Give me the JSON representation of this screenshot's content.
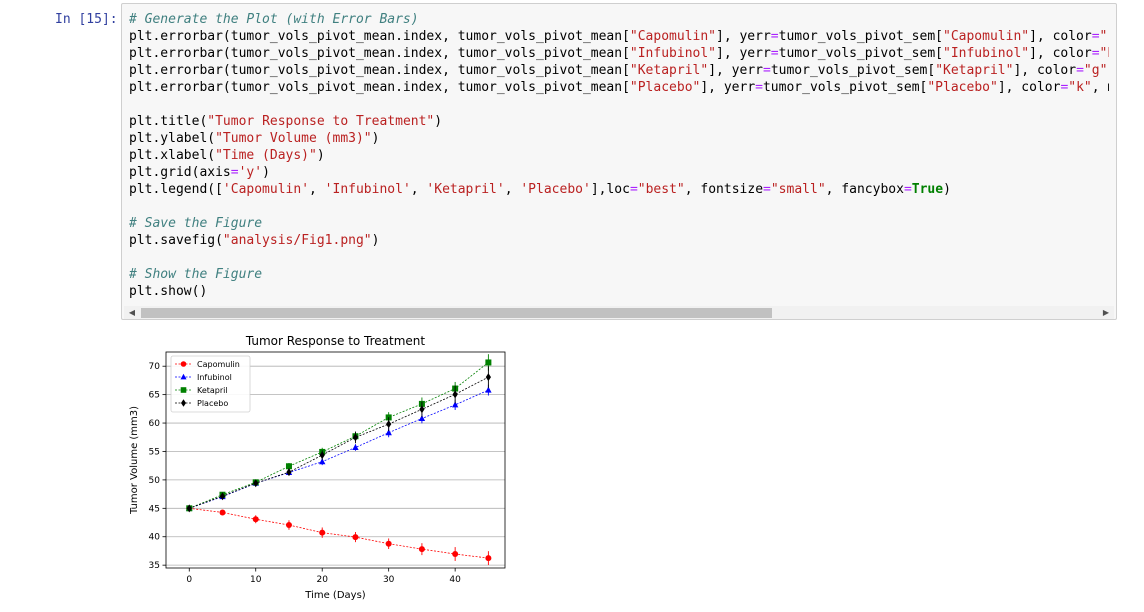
{
  "cell": {
    "prompt": "In [15]:",
    "code_lines": [
      [
        {
          "t": "# Generate the Plot (with Error Bars)",
          "c": "cm"
        }
      ],
      [
        {
          "t": "plt.errorbar(tumor_vols_pivot_mean.index, tumor_vols_pivot_mean["
        },
        {
          "t": "\"Capomulin\"",
          "c": "st"
        },
        {
          "t": "], yerr"
        },
        {
          "t": "=",
          "c": "op"
        },
        {
          "t": "tumor_vols_pivot_sem["
        },
        {
          "t": "\"Capomulin\"",
          "c": "st"
        },
        {
          "t": "], color"
        },
        {
          "t": "=",
          "c": "op"
        },
        {
          "t": "\"r\"",
          "c": "st"
        },
        {
          "t": ", "
        }
      ],
      [
        {
          "t": "plt.errorbar(tumor_vols_pivot_mean.index, tumor_vols_pivot_mean["
        },
        {
          "t": "\"Infubinol\"",
          "c": "st"
        },
        {
          "t": "], yerr"
        },
        {
          "t": "=",
          "c": "op"
        },
        {
          "t": "tumor_vols_pivot_sem["
        },
        {
          "t": "\"Infubinol\"",
          "c": "st"
        },
        {
          "t": "], color"
        },
        {
          "t": "=",
          "c": "op"
        },
        {
          "t": "\"b\"",
          "c": "st"
        },
        {
          "t": ", "
        }
      ],
      [
        {
          "t": "plt.errorbar(tumor_vols_pivot_mean.index, tumor_vols_pivot_mean["
        },
        {
          "t": "\"Ketapril\"",
          "c": "st"
        },
        {
          "t": "], yerr"
        },
        {
          "t": "=",
          "c": "op"
        },
        {
          "t": "tumor_vols_pivot_sem["
        },
        {
          "t": "\"Ketapril\"",
          "c": "st"
        },
        {
          "t": "], color"
        },
        {
          "t": "=",
          "c": "op"
        },
        {
          "t": "\"g\"",
          "c": "st"
        },
        {
          "t": ", ma"
        }
      ],
      [
        {
          "t": "plt.errorbar(tumor_vols_pivot_mean.index, tumor_vols_pivot_mean["
        },
        {
          "t": "\"Placebo\"",
          "c": "st"
        },
        {
          "t": "], yerr"
        },
        {
          "t": "=",
          "c": "op"
        },
        {
          "t": "tumor_vols_pivot_sem["
        },
        {
          "t": "\"Placebo\"",
          "c": "st"
        },
        {
          "t": "], color"
        },
        {
          "t": "=",
          "c": "op"
        },
        {
          "t": "\"k\"",
          "c": "st"
        },
        {
          "t": ", mark"
        }
      ],
      [],
      [
        {
          "t": "plt.title("
        },
        {
          "t": "\"Tumor Response to Treatment\"",
          "c": "st"
        },
        {
          "t": ")"
        }
      ],
      [
        {
          "t": "plt.ylabel("
        },
        {
          "t": "\"Tumor Volume (mm3)\"",
          "c": "st"
        },
        {
          "t": ")"
        }
      ],
      [
        {
          "t": "plt.xlabel("
        },
        {
          "t": "\"Time (Days)\"",
          "c": "st"
        },
        {
          "t": ")"
        }
      ],
      [
        {
          "t": "plt.grid(axis"
        },
        {
          "t": "=",
          "c": "op"
        },
        {
          "t": "'y'",
          "c": "st"
        },
        {
          "t": ")"
        }
      ],
      [
        {
          "t": "plt.legend(["
        },
        {
          "t": "'Capomulin'",
          "c": "st"
        },
        {
          "t": ", "
        },
        {
          "t": "'Infubinol'",
          "c": "st"
        },
        {
          "t": ", "
        },
        {
          "t": "'Ketapril'",
          "c": "st"
        },
        {
          "t": ", "
        },
        {
          "t": "'Placebo'",
          "c": "st"
        },
        {
          "t": "],loc"
        },
        {
          "t": "=",
          "c": "op"
        },
        {
          "t": "\"best\"",
          "c": "st"
        },
        {
          "t": ", fontsize"
        },
        {
          "t": "=",
          "c": "op"
        },
        {
          "t": "\"small\"",
          "c": "st"
        },
        {
          "t": ", fancybox"
        },
        {
          "t": "=",
          "c": "op"
        },
        {
          "t": "True",
          "c": "kw"
        },
        {
          "t": ")"
        }
      ],
      [],
      [
        {
          "t": "# Save the Figure",
          "c": "cm"
        }
      ],
      [
        {
          "t": "plt.savefig("
        },
        {
          "t": "\"analysis/Fig1.png\"",
          "c": "st"
        },
        {
          "t": ")"
        }
      ],
      [],
      [
        {
          "t": "# Show the Figure",
          "c": "cm"
        }
      ],
      [
        {
          "t": "plt.show()"
        }
      ]
    ],
    "scrollbar": {
      "left_arrow": "◀",
      "right_arrow": "▶",
      "thumb_fraction": 0.66
    }
  },
  "chart_data": {
    "type": "line",
    "title": "Tumor Response to Treatment",
    "xlabel": "Time (Days)",
    "ylabel": "Tumor Volume (mm3)",
    "xlim": [
      -3.5,
      47.5
    ],
    "ylim": [
      34.5,
      72.5
    ],
    "xticks": [
      0,
      10,
      20,
      30,
      40
    ],
    "yticks": [
      35,
      40,
      45,
      50,
      55,
      60,
      65,
      70
    ],
    "grid": "y",
    "legend_position": "top-left",
    "x": [
      0,
      5,
      10,
      15,
      20,
      25,
      30,
      35,
      40,
      45
    ],
    "series": [
      {
        "name": "Capomulin",
        "color": "#ff0000",
        "marker": "circle",
        "values": [
          45.0,
          44.27,
          43.08,
          42.06,
          40.72,
          39.94,
          38.77,
          37.82,
          36.96,
          36.24
        ],
        "errors": [
          0,
          0.45,
          0.7,
          0.84,
          0.91,
          0.89,
          0.93,
          1.05,
          1.22,
          1.22
        ]
      },
      {
        "name": "Infubinol",
        "color": "#0000ff",
        "marker": "triangle",
        "values": [
          45.0,
          47.06,
          49.4,
          51.3,
          53.2,
          55.7,
          58.3,
          60.8,
          63.2,
          65.8
        ],
        "errors": [
          0,
          0.24,
          0.31,
          0.39,
          0.6,
          0.58,
          0.8,
          0.85,
          0.9,
          0.96
        ]
      },
      {
        "name": "Ketapril",
        "color": "#008000",
        "marker": "square",
        "values": [
          45.0,
          47.39,
          49.58,
          52.4,
          54.92,
          57.68,
          60.99,
          63.37,
          66.07,
          70.66
        ],
        "errors": [
          0,
          0.26,
          0.36,
          0.58,
          0.73,
          0.76,
          0.93,
          1.13,
          1.16,
          1.45
        ]
      },
      {
        "name": "Placebo",
        "color": "#000000",
        "marker": "diamond",
        "values": [
          45.0,
          47.13,
          49.42,
          51.36,
          54.36,
          57.48,
          59.81,
          62.42,
          65.05,
          68.08
        ],
        "errors": [
          0,
          0.22,
          0.4,
          0.61,
          0.84,
          1.03,
          1.22,
          1.35,
          1.56,
          1.89
        ]
      }
    ]
  }
}
